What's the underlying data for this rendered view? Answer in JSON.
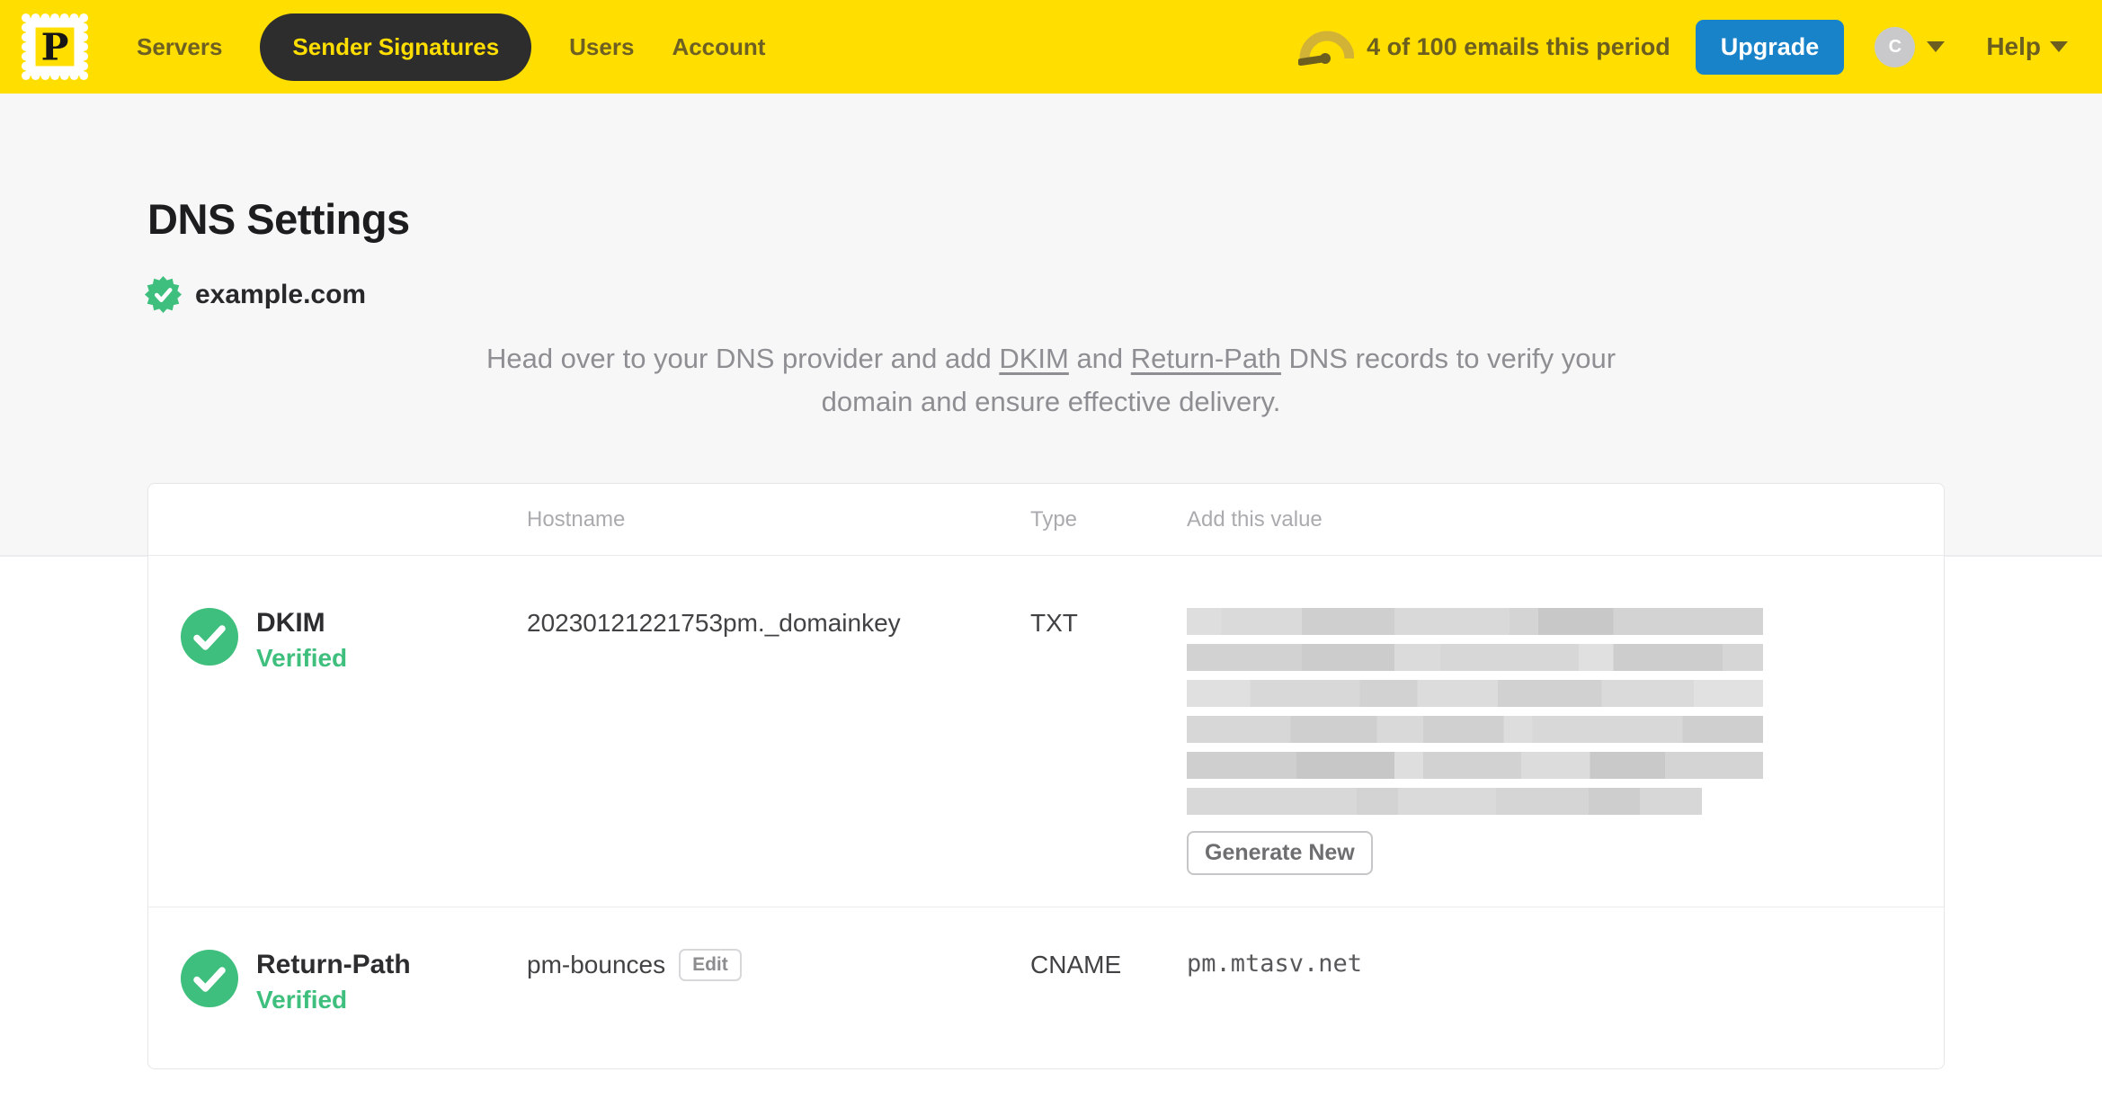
{
  "navbar": {
    "logo_letter": "P",
    "items": [
      {
        "label": "Servers",
        "active": false
      },
      {
        "label": "Sender Signatures",
        "active": true
      },
      {
        "label": "Users",
        "active": false
      },
      {
        "label": "Account",
        "active": false
      }
    ],
    "usage_text": "4 of 100 emails this period",
    "upgrade_label": "Upgrade",
    "avatar_initial": "C",
    "help_label": "Help"
  },
  "page": {
    "title": "DNS Settings",
    "domain": "example.com",
    "domain_status": "verified",
    "intro": {
      "prefix": "Head over to your DNS provider and add ",
      "link_dkim": "DKIM",
      "and": " and ",
      "link_return_path": "Return-Path",
      "suffix": " DNS records to verify your domain and ensure effective delivery."
    }
  },
  "dns_table": {
    "headers": {
      "hostname": "Hostname",
      "type": "Type",
      "value": "Add this value"
    },
    "rows": [
      {
        "name": "DKIM",
        "status": "Verified",
        "hostname": "20230121221753pm._domainkey",
        "type": "TXT",
        "value_redacted": true,
        "action_label": "Generate New"
      },
      {
        "name": "Return-Path",
        "status": "Verified",
        "hostname": "pm-bounces",
        "edit_label": "Edit",
        "type": "CNAME",
        "value": "pm.mtasv.net"
      }
    ]
  },
  "colors": {
    "brand_yellow": "#FFDE00",
    "nav_active_bg": "#2D2D2D",
    "upgrade_blue": "#1983CA",
    "verified_green": "#3FBF7D",
    "hero_bg": "#F7F7F8"
  }
}
